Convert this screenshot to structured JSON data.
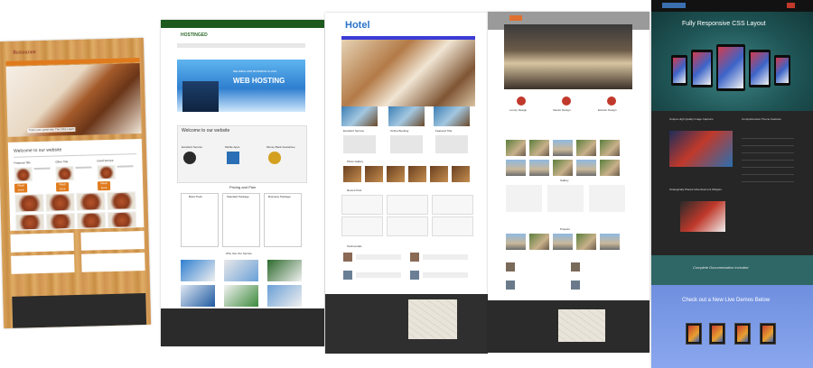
{
  "restaurant": {
    "logo": "Restaurant",
    "hero_caption": "That's your great site, The Ultra Lawn!",
    "welcome": "Welcome to our website",
    "col_titles": [
      "Featured Title",
      "Other Title",
      "Good Service"
    ],
    "read_more": "Read more"
  },
  "hosting": {
    "logo": "HOSTINGED",
    "hero_line1": "RELIABLE AND BUSINESS CLASS",
    "hero_line2": "WEB HOSTING",
    "welcome": "Welcome to our website",
    "features": [
      "Excellent Service",
      "Mobile Apps",
      "Money Back Guarantee"
    ],
    "pricing_title": "Pricing and Plan",
    "plans": [
      "Basic Pack",
      "Standard Package",
      "Business Package"
    ],
    "services_title": "Why Use Our Service"
  },
  "hotel": {
    "logo": "Hotel",
    "features": [
      "Excellent Service",
      "Online Booking",
      "Featured Title"
    ],
    "gallery_title": "Photo Gallery",
    "posts_title": "Recent Post",
    "testimonials_title": "Testimonials"
  },
  "architecture": {
    "features": [
      "Luxury Design",
      "Interior Design",
      "Exterior Design"
    ],
    "gallery_title": "Gallery",
    "projects_title": "Projects"
  },
  "responsive": {
    "title": "Fully Responsive CSS Layout",
    "feature_left": "Unique High Quality Image Captions",
    "feature_right": "Comprehensive Theme Features",
    "feature_lower": "Strategically Placed Advertisement Widgets",
    "documentation": "Complete Documentation Included",
    "cta": "Check out a New Live Demos Below"
  }
}
